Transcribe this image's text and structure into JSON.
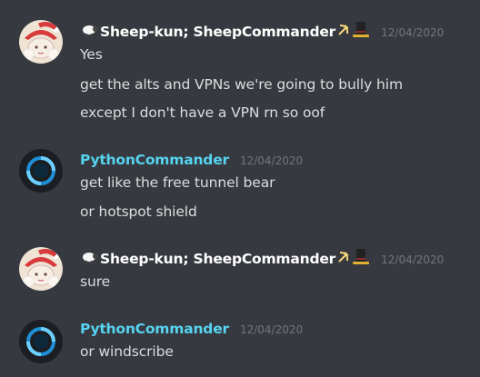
{
  "colors": {
    "background": "#36393f",
    "sheep_name": "#ffffff",
    "python_name": "#56d4f0",
    "text": "#dcddde",
    "timestamp": "#72767d"
  },
  "messages": [
    {
      "author": "Sheep-kun; SheepCommander",
      "author_icons": [
        "sheep-icon",
        "hammer-sickle-icon",
        "top-hat-icon"
      ],
      "timestamp": "12/04/2020",
      "lines": [
        "Yes",
        "get the alts and VPNs we're going to bully him",
        "except I don't have a VPN rn so  oof"
      ]
    },
    {
      "author": "PythonCommander",
      "author_icons": [],
      "timestamp": "12/04/2020",
      "lines": [
        "get like the free tunnel bear",
        "or hotspot shield"
      ]
    },
    {
      "author": "Sheep-kun; SheepCommander",
      "author_icons": [
        "sheep-icon",
        "hammer-sickle-icon",
        "top-hat-icon"
      ],
      "timestamp": "12/04/2020",
      "lines": [
        "sure"
      ]
    },
    {
      "author": "PythonCommander",
      "author_icons": [],
      "timestamp": "12/04/2020",
      "lines": [
        "or windscribe"
      ]
    }
  ]
}
